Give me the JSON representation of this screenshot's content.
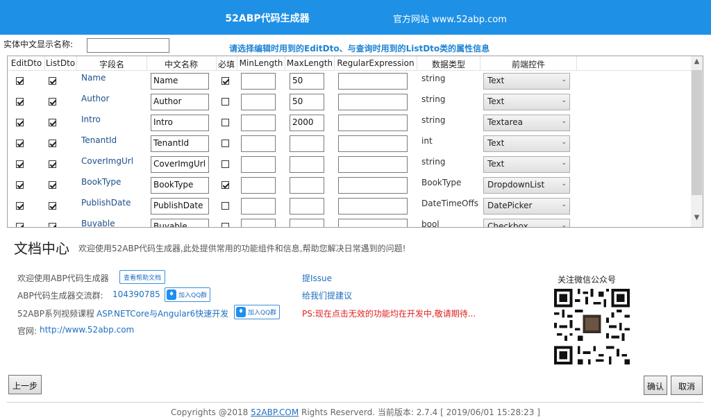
{
  "header": {
    "title": "52ABP代码生成器",
    "website": "官方网站 www.52abp.com"
  },
  "entity": {
    "label": "实体中文显示名称:",
    "value": ""
  },
  "hint": "请选择编辑时用到的EditDto、与查询时用到的ListDto类的属性信息",
  "grid": {
    "columns": [
      "EditDto",
      "ListDto",
      "字段名",
      "中文名称",
      "必填",
      "MinLength",
      "MaxLength",
      "RegularExpression",
      "数据类型",
      "前端控件"
    ],
    "rows": [
      {
        "field": "Name",
        "cn": "Name",
        "required": true,
        "max": "50",
        "dtype": "string",
        "control": "Text"
      },
      {
        "field": "Author",
        "cn": "Author",
        "required": false,
        "max": "50",
        "dtype": "string",
        "control": "Text"
      },
      {
        "field": "Intro",
        "cn": "Intro",
        "required": false,
        "max": "2000",
        "dtype": "string",
        "control": "Textarea"
      },
      {
        "field": "TenantId",
        "cn": "TenantId",
        "required": false,
        "max": "",
        "dtype": "int",
        "control": "Text"
      },
      {
        "field": "CoverImgUrl",
        "cn": "CoverImgUrl",
        "required": false,
        "max": "",
        "dtype": "string",
        "control": "Text"
      },
      {
        "field": "BookType",
        "cn": "BookType",
        "required": true,
        "max": "",
        "dtype": "BookType",
        "control": "DropdownList"
      },
      {
        "field": "PublishDate",
        "cn": "PublishDate",
        "required": false,
        "max": "",
        "dtype": "DateTimeOffs",
        "control": "DatePicker"
      },
      {
        "field": "Buyable",
        "cn": "Buyable",
        "required": false,
        "max": "",
        "dtype": "bool",
        "control": "Checkbox"
      }
    ]
  },
  "doc": {
    "title": "文档中心",
    "subtitle": "欢迎使用52ABP代码生成器,此处提供常用的功能组件和信息,帮助您解决日常遇到的问题!",
    "welcome": "欢迎使用ABP代码生成器",
    "help_btn": "查看帮助文档",
    "group_label": "ABP代码生成器交流群:",
    "group_num": "104390785",
    "qq_btn": "加入QQ群",
    "course_label": "52ABP系列视频课程",
    "course_link": "ASP.NETCore与Angular6快速开发",
    "site_label": "官网:",
    "site_link": "http://www.52abp.com",
    "issue": "提Issue",
    "suggest": "给我们提建议",
    "ps": "PS:现在点击无效的功能均在开发中,敬请期待...",
    "wechat": "关注微信公众号"
  },
  "buttons": {
    "prev": "上一步",
    "ok": "确认",
    "cancel": "取消"
  },
  "footer": {
    "pre": "Copyrights @2018 ",
    "link": "52ABP.COM",
    "post": " Rights Reserverd. 当前版本: 2.7.4 [ 2019/06/01 15:28:23 ]"
  }
}
